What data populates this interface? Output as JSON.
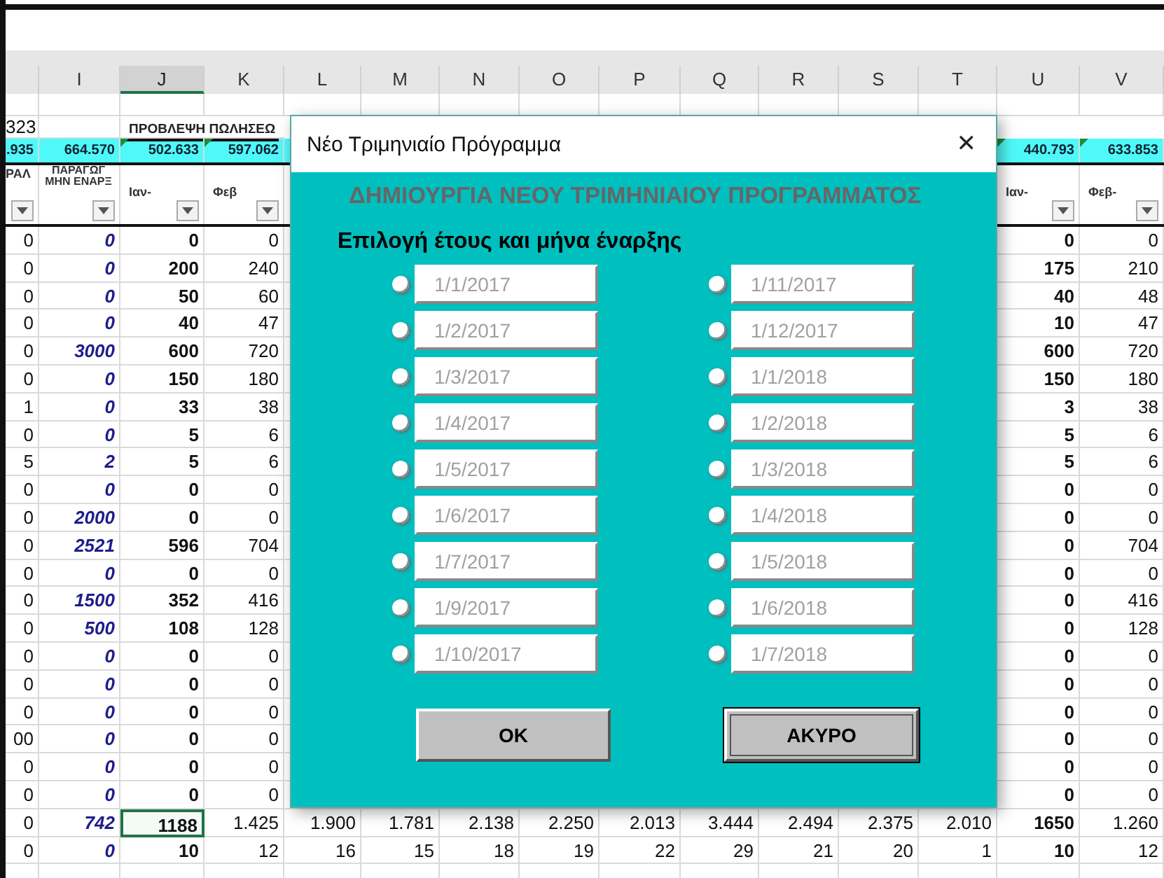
{
  "columns": [
    {
      "label": "I",
      "selected": false
    },
    {
      "label": "J",
      "selected": true
    },
    {
      "label": "K",
      "selected": false
    },
    {
      "label": "L",
      "selected": false
    },
    {
      "label": "M",
      "selected": false
    },
    {
      "label": "N",
      "selected": false
    },
    {
      "label": "O",
      "selected": false
    },
    {
      "label": "P",
      "selected": false
    },
    {
      "label": "Q",
      "selected": false
    },
    {
      "label": "R",
      "selected": false
    },
    {
      "label": "S",
      "selected": false
    },
    {
      "label": "T",
      "selected": false
    },
    {
      "label": "U",
      "selected": false
    },
    {
      "label": "V",
      "selected": false
    }
  ],
  "title_row": {
    "h": "323",
    "jk": "ΠΡΟΒΛΕΨΗ ΠΩΛΗΣΕΩ"
  },
  "totals_row": [
    {
      "text": ".935",
      "marker": false
    },
    {
      "text": "664.570",
      "marker": false
    },
    {
      "text": "502.633",
      "marker": true
    },
    {
      "text": "597.062",
      "marker": true
    },
    {
      "text": "440.793",
      "marker": true
    },
    {
      "text": "633.853",
      "marker": true
    }
  ],
  "header_row": [
    {
      "text": "ΡΑΛ"
    },
    {
      "text": "ΠΑΡΑΓΩΓ ΜΗΝ ΕΝΑΡΞ"
    },
    {
      "text": "Ιαν-"
    },
    {
      "text": "Φεβ"
    },
    {
      "text": "Ιαν-"
    },
    {
      "text": "Φεβ-"
    }
  ],
  "rows": [
    {
      "h": "0",
      "i": "0",
      "j": "0",
      "k": "0",
      "u": "0",
      "v": "0",
      "j_selected": false
    },
    {
      "h": "0",
      "i": "0",
      "j": "200",
      "k": "240",
      "u": "175",
      "v": "210",
      "j_selected": false
    },
    {
      "h": "0",
      "i": "0",
      "j": "50",
      "k": "60",
      "u": "40",
      "v": "48",
      "j_selected": false
    },
    {
      "h": "0",
      "i": "0",
      "j": "40",
      "k": "47",
      "u": "10",
      "v": "47",
      "j_selected": false
    },
    {
      "h": "0",
      "i": "3000",
      "j": "600",
      "k": "720",
      "u": "600",
      "v": "720",
      "j_selected": false
    },
    {
      "h": "0",
      "i": "0",
      "j": "150",
      "k": "180",
      "u": "150",
      "v": "180",
      "j_selected": false
    },
    {
      "h": "1",
      "i": "0",
      "j": "33",
      "k": "38",
      "u": "3",
      "v": "38",
      "j_selected": false
    },
    {
      "h": "0",
      "i": "0",
      "j": "5",
      "k": "6",
      "u": "5",
      "v": "6",
      "j_selected": false
    },
    {
      "h": "5",
      "i": "2",
      "j": "5",
      "k": "6",
      "u": "5",
      "v": "6",
      "j_selected": false
    },
    {
      "h": "0",
      "i": "0",
      "j": "0",
      "k": "0",
      "u": "0",
      "v": "0",
      "j_selected": false
    },
    {
      "h": "0",
      "i": "2000",
      "j": "0",
      "k": "0",
      "u": "0",
      "v": "0",
      "j_selected": false
    },
    {
      "h": "0",
      "i": "2521",
      "j": "596",
      "k": "704",
      "u": "0",
      "v": "704",
      "j_selected": false
    },
    {
      "h": "0",
      "i": "0",
      "j": "0",
      "k": "0",
      "u": "0",
      "v": "0",
      "j_selected": false
    },
    {
      "h": "0",
      "i": "1500",
      "j": "352",
      "k": "416",
      "u": "0",
      "v": "416",
      "j_selected": false
    },
    {
      "h": "0",
      "i": "500",
      "j": "108",
      "k": "128",
      "u": "0",
      "v": "128",
      "j_selected": false
    },
    {
      "h": "0",
      "i": "0",
      "j": "0",
      "k": "0",
      "u": "0",
      "v": "0",
      "j_selected": false
    },
    {
      "h": "0",
      "i": "0",
      "j": "0",
      "k": "0",
      "u": "0",
      "v": "0",
      "j_selected": false
    },
    {
      "h": "0",
      "i": "0",
      "j": "0",
      "k": "0",
      "u": "0",
      "v": "0",
      "j_selected": false
    },
    {
      "h": "00",
      "i": "0",
      "j": "0",
      "k": "0",
      "u": "0",
      "v": "0",
      "j_selected": false
    },
    {
      "h": "0",
      "i": "0",
      "j": "0",
      "k": "0",
      "u": "0",
      "v": "0",
      "j_selected": false
    },
    {
      "h": "0",
      "i": "0",
      "j": "0",
      "k": "0",
      "u": "0",
      "v": "0",
      "j_selected": false
    },
    {
      "h": "0",
      "i": "742",
      "j": "1188",
      "k": "1.425",
      "mid": [
        "1.900",
        "1.781",
        "2.138",
        "2.250",
        "2.013",
        "3.444",
        "2.494",
        "2.375",
        "2.010"
      ],
      "u": "1650",
      "v": "1.260",
      "j_selected": true
    },
    {
      "h": "0",
      "i": "0",
      "j": "10",
      "k": "12",
      "mid": [
        "16",
        "15",
        "18",
        "19",
        "22",
        "29",
        "21",
        "20",
        "1"
      ],
      "u": "10",
      "v": "12",
      "j_selected": false
    }
  ],
  "dialog": {
    "title": "Νέο Τριμηνιαίο Πρόγραμμα",
    "close": "✕",
    "heading": "ΔΗΜΙΟΥΡΓΙΑ ΝΕΟΥ ΤΡΙΜΗΝΙΑΙΟΥ ΠΡΟΓΡΑΜΜΑΤΟΣ",
    "subheading": "Επιλογή έτους και μήνα έναρξης",
    "options_left": [
      {
        "value": "1/1/2017",
        "selected": false,
        "disabled": true
      },
      {
        "value": "1/2/2017",
        "selected": false,
        "disabled": true
      },
      {
        "value": "1/3/2017",
        "selected": false,
        "disabled": true
      },
      {
        "value": "1/4/2017",
        "selected": false,
        "disabled": true
      },
      {
        "value": "1/5/2017",
        "selected": false,
        "disabled": true
      },
      {
        "value": "1/6/2017",
        "selected": false,
        "disabled": true
      },
      {
        "value": "1/7/2017",
        "selected": false,
        "disabled": true
      },
      {
        "value": "1/9/2017",
        "selected": false,
        "disabled": true
      },
      {
        "value": "1/10/2017",
        "selected": false,
        "disabled": true
      }
    ],
    "options_right": [
      {
        "value": "1/11/2017",
        "selected": false,
        "disabled": true
      },
      {
        "value": "1/12/2017",
        "selected": false,
        "disabled": true
      },
      {
        "value": "1/1/2018",
        "selected": false,
        "disabled": true
      },
      {
        "value": "1/2/2018",
        "selected": false,
        "disabled": true
      },
      {
        "value": "1/3/2018",
        "selected": false,
        "disabled": true
      },
      {
        "value": "1/4/2018",
        "selected": false,
        "disabled": true
      },
      {
        "value": "1/5/2018",
        "selected": false,
        "disabled": true
      },
      {
        "value": "1/6/2018",
        "selected": false,
        "disabled": true
      },
      {
        "value": "1/7/2018",
        "selected": false,
        "disabled": true
      }
    ],
    "buttons": [
      {
        "label": "OK",
        "focused": false
      },
      {
        "label": "ΑΚΥΡΟ",
        "focused": true
      }
    ]
  }
}
